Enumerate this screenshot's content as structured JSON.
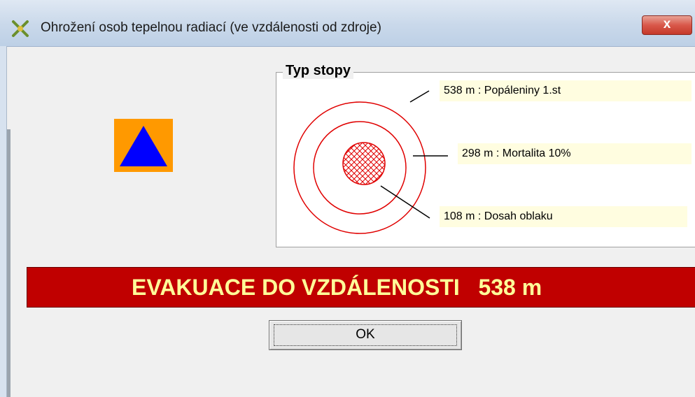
{
  "window": {
    "title": "Ohrožení osob tepelnou radiací (ve vzdálenosti od zdroje)",
    "close_label": "x"
  },
  "icon": {
    "name": "hazard-triangle-icon",
    "bg_color": "#ff9900",
    "fg_color": "#0000ff"
  },
  "group": {
    "title": "Typ stopy",
    "labels": [
      "538 m : Popáleniny 1.st",
      "298 m : Mortalita 10%",
      "108 m : Dosah oblaku"
    ]
  },
  "evacuation": {
    "text": "EVAKUACE DO VZDÁLENOSTI   538 m",
    "bg_color": "#c00000",
    "text_color": "#ffff99"
  },
  "buttons": {
    "ok_label": "OK"
  }
}
